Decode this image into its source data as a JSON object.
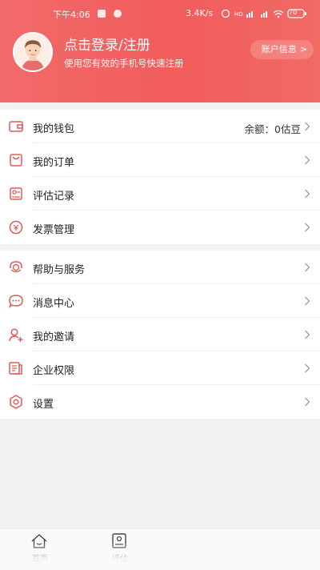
{
  "status_bar": {
    "time": "下午4:06",
    "network_speed": "3.4K/s",
    "battery": "70"
  },
  "header": {
    "login_title": "点击登录/注册",
    "login_subtitle": "使用您有效的手机号快速注册",
    "account_button_label": "账户信息"
  },
  "menu_group_1": [
    {
      "label": "我的钱包",
      "value": "余额：0估豆",
      "icon": "wallet-icon"
    },
    {
      "label": "我的订单",
      "value": "",
      "icon": "order-icon"
    },
    {
      "label": "评估记录",
      "value": "",
      "icon": "record-icon"
    },
    {
      "label": "发票管理",
      "value": "",
      "icon": "invoice-icon"
    }
  ],
  "menu_group_2": [
    {
      "label": "帮助与服务",
      "icon": "headset-icon"
    },
    {
      "label": "消息中心",
      "icon": "message-icon"
    },
    {
      "label": "我的邀请",
      "icon": "invite-user-icon"
    },
    {
      "label": "企业权限",
      "icon": "enterprise-icon"
    },
    {
      "label": "设置",
      "icon": "settings-icon"
    }
  ],
  "tabbar": {
    "items": [
      {
        "label": "首页",
        "icon": "home-icon"
      },
      {
        "label": "评估",
        "icon": "assess-icon"
      }
    ]
  },
  "colors": {
    "brand": "#f15c5c",
    "icon_accent": "#e05a5a",
    "background": "#f2f2f2"
  }
}
